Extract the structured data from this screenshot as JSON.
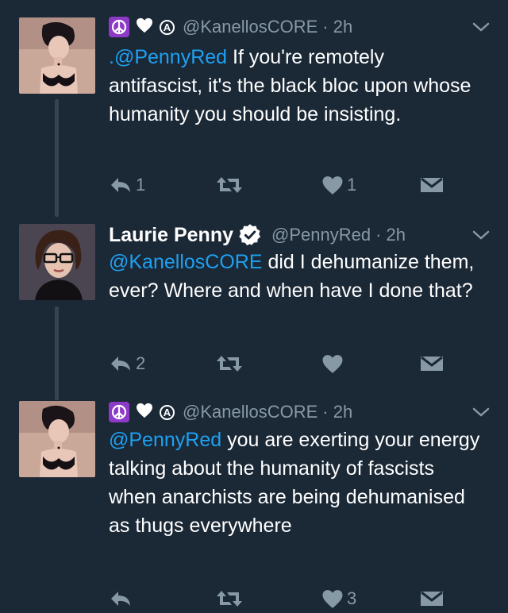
{
  "tweets": [
    {
      "display_name": "",
      "handle": "@KanellosCORE",
      "time": "· 2h",
      "mention": ".@PennyRed",
      "text": " If you're remotely antifascist, it's the black bloc upon whose humanity you should be insisting.",
      "reply_count": "1",
      "retweet_count": "",
      "like_count": "1"
    },
    {
      "display_name": "Laurie Penny",
      "handle": "@PennyRed",
      "time": "· 2h",
      "mention": "@KanellosCORE",
      "text": " did I dehumanize them, ever? Where and when have I done that?",
      "reply_count": "2",
      "retweet_count": "",
      "like_count": ""
    },
    {
      "display_name": "",
      "handle": "@KanellosCORE",
      "time": "· 2h",
      "mention": "@PennyRed",
      "text": " you are exerting your energy talking about the humanity of fascists when anarchists are being dehumanised as thugs everywhere",
      "reply_count": "",
      "retweet_count": "",
      "like_count": "3"
    }
  ],
  "name_emoji": {
    "anarchy_symbol": "A"
  },
  "icons": {
    "peace": "peace-symbol-icon",
    "heart": "heart-icon",
    "verified": "verified-badge-icon",
    "chevron": "chevron-down-icon",
    "reply": "reply-icon",
    "retweet": "retweet-icon",
    "like": "like-icon",
    "dm": "direct-message-icon"
  },
  "colors": {
    "background": "#1b2836",
    "link": "#1da1f2",
    "muted": "#8899a6",
    "peace_emoji_bg": "#8e3ac9"
  }
}
